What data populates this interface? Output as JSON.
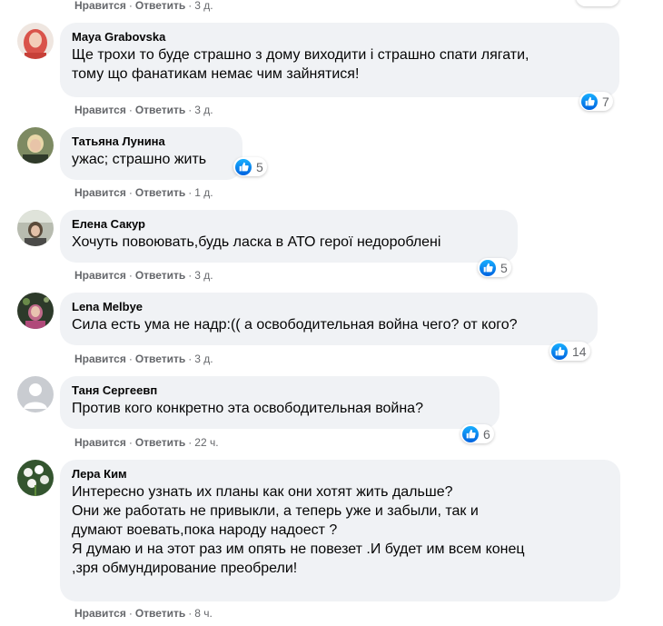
{
  "labels": {
    "like": "Нравится",
    "reply": "Ответить",
    "sep": "·"
  },
  "top_row": {
    "time": "3 д."
  },
  "comments": [
    {
      "author": "Maya Grabovska",
      "text": "Ще трохи то буде страшно з дому виходити і страшно спати лягати, \nтому що фанатикам немає чим зайнятися!",
      "likes": "7",
      "time": "3 д.",
      "avatar_color": "#d9534a"
    },
    {
      "author": "Татьяна Лунина",
      "text": "ужас; страшно жить",
      "likes": "5",
      "time": "1 д.",
      "avatar_color": "#6b7a52"
    },
    {
      "author": "Елена Сакур",
      "text": "Хочуть повоювать,будь ласка в АТО герої недороблені",
      "likes": "5",
      "time": "3 д.",
      "avatar_color": "#8a8f7a"
    },
    {
      "author": "Lena Melbye",
      "text": "Сила есть ума не надр:(( а освободительная война чего? от кого?",
      "likes": "14",
      "time": "3 д.",
      "avatar_color": "#7a4a6a"
    },
    {
      "author": "Таня Сергеевп",
      "text": "Против кого конкретно эта освободительная война?",
      "likes": "6",
      "time": "22 ч.",
      "avatar_color": "#c9ccd1"
    },
    {
      "author": "Лера Ким",
      "text": "Интересно узнать их планы как они хотят жить дальше?\nОни же работать не привыкли, а теперь уже и забыли, так и \nдумают воевать,пока народу надоест ?\nЯ думаю и на этот раз им опять не повезет .И будет им всем конец\n,зря обмундирование преобрели!",
      "likes": "",
      "time": "8 ч.",
      "avatar_color": "#3f6b3a"
    }
  ]
}
